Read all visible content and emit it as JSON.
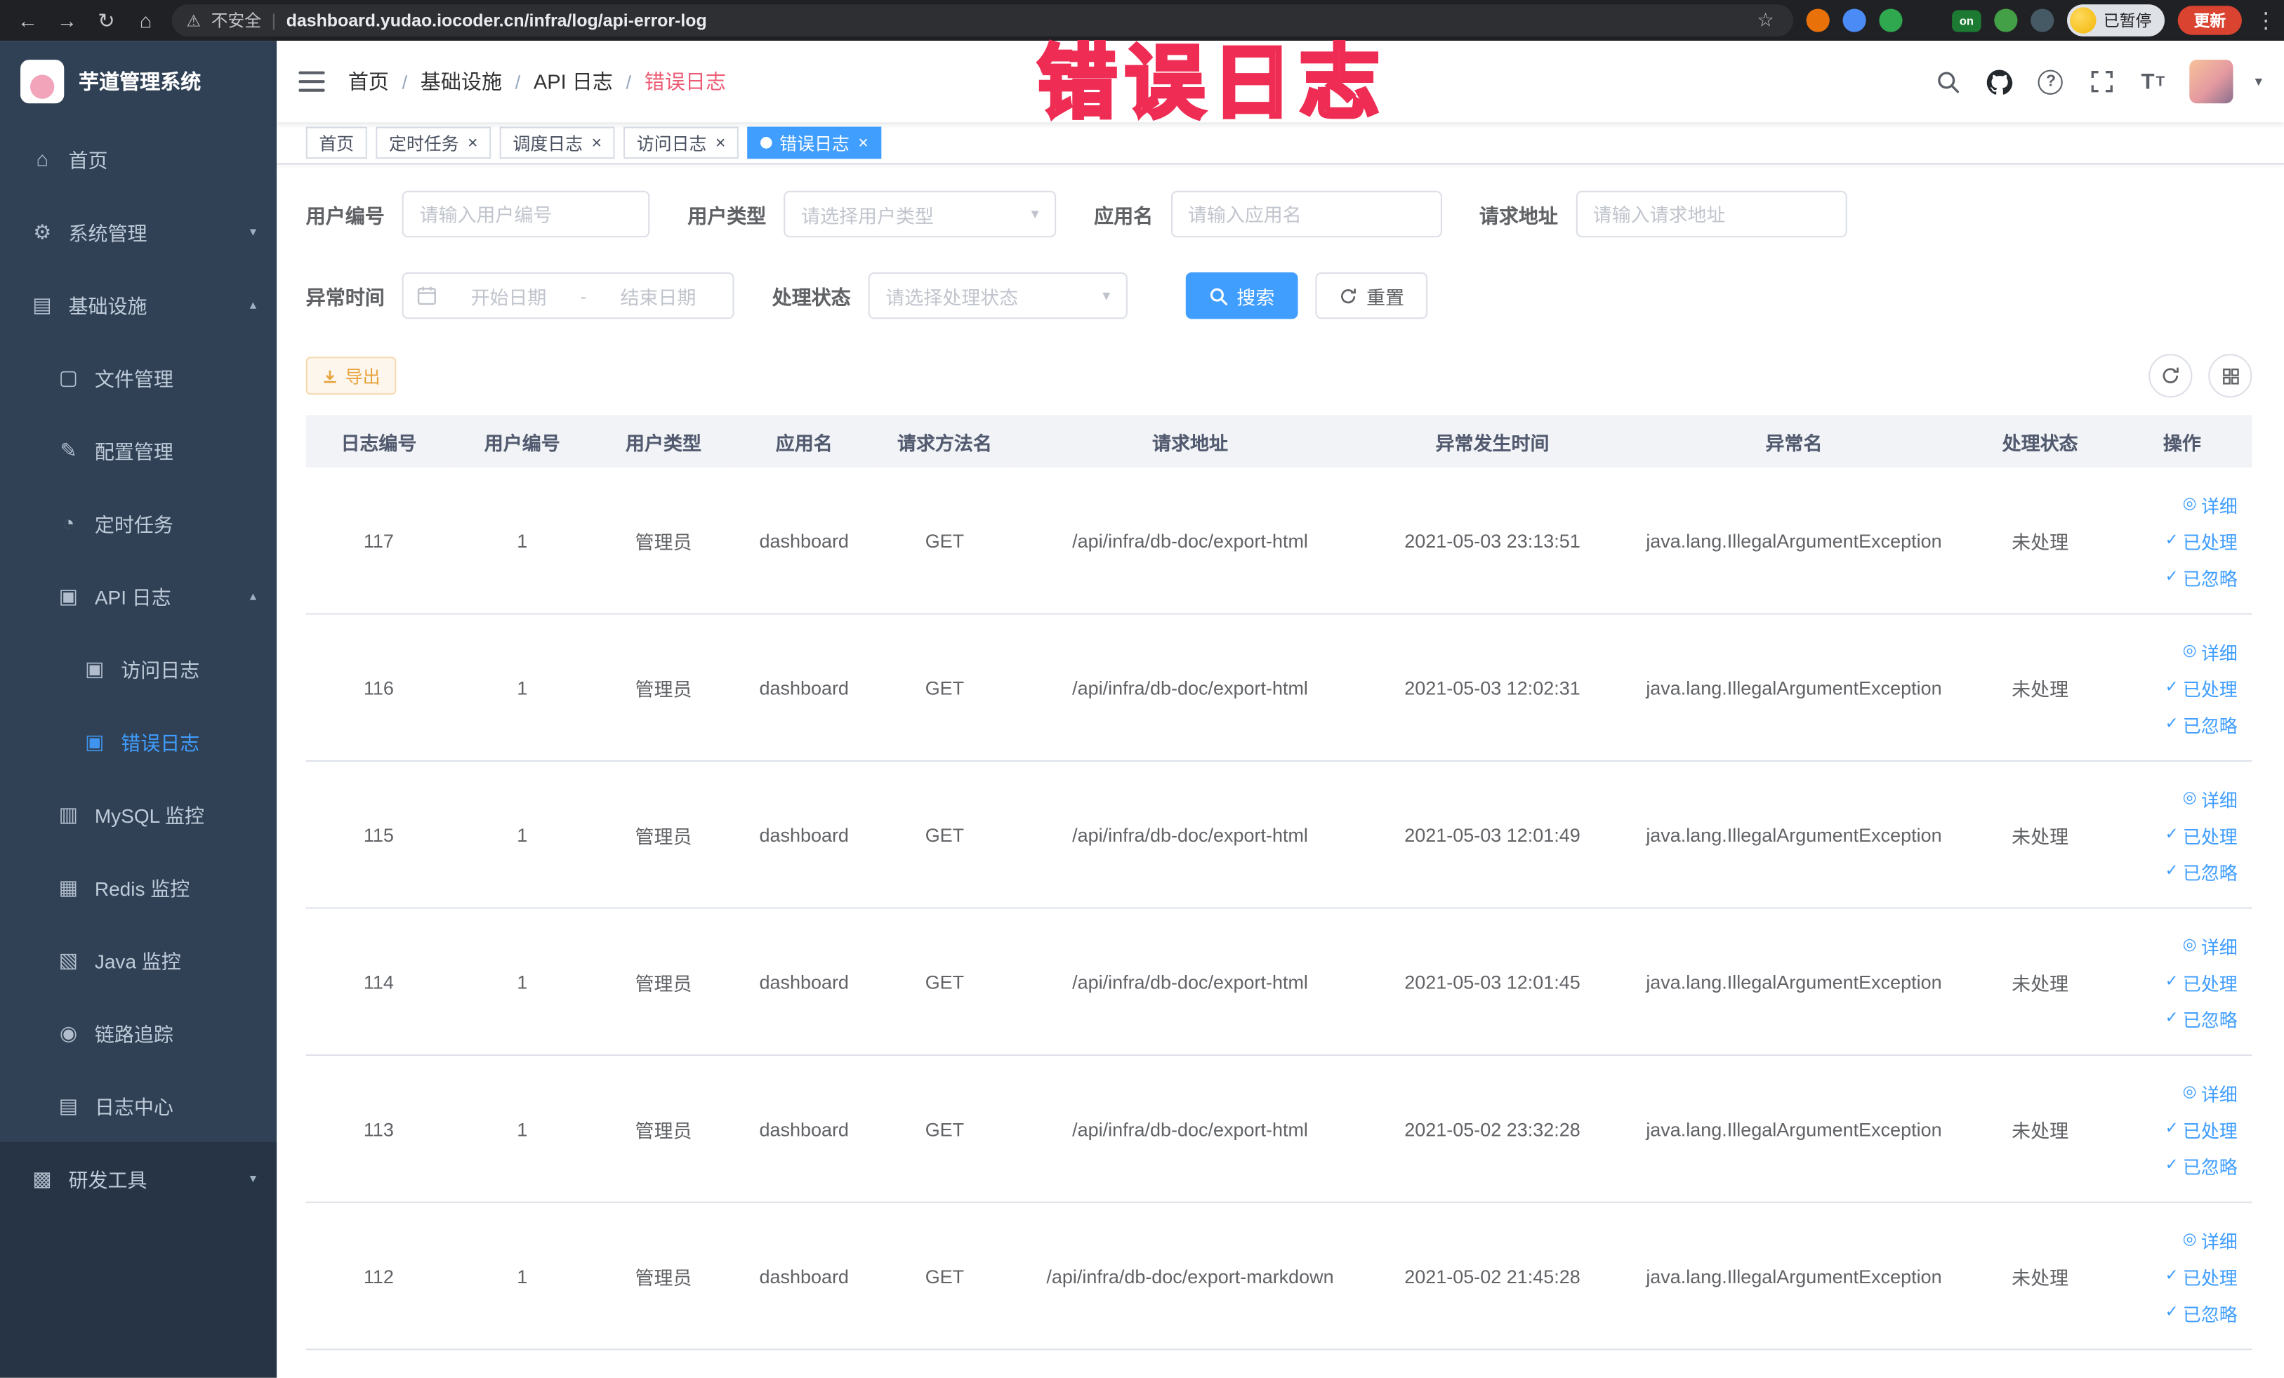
{
  "colors": {
    "primary": "#409eff",
    "sidebar_bg": "#304156",
    "annotation_red": "#ee2c54",
    "warning_orange": "#e6a23c",
    "active_tab": "#409eff"
  },
  "annotation": "错误日志",
  "browser": {
    "security_label": "不安全",
    "url": "dashboard.yudao.iocoder.cn/infra/log/api-error-log",
    "paused_badge": "已暂停",
    "update_button": "更新",
    "extensions": [
      {
        "name": "extension-icon-1",
        "color": "#e8710a",
        "shape": "circle"
      },
      {
        "name": "extension-icon-2",
        "color": "#4b8bf5",
        "shape": "circle"
      },
      {
        "name": "extension-icon-3",
        "color": "#2fa84f",
        "shape": "circle"
      },
      {
        "name": "extension-icon-4",
        "color": "#4285f4",
        "shape": "grid"
      },
      {
        "name": "extension-icon-on-badge",
        "color": "#1d7a33",
        "shape": "square",
        "label": "on"
      },
      {
        "name": "extension-icon-6",
        "color": "#43a047",
        "shape": "circle"
      },
      {
        "name": "extension-icon-7",
        "color": "#455a64",
        "shape": "circle"
      }
    ]
  },
  "sidebar": {
    "title": "芋道管理系统",
    "items": [
      {
        "key": "home",
        "label": "首页",
        "icon": "home-icon",
        "level": 0
      },
      {
        "key": "system-management",
        "label": "系统管理",
        "icon": "gear-icon",
        "level": 0,
        "expandable": true,
        "expanded": false
      },
      {
        "key": "infrastructure",
        "label": "基础设施",
        "icon": "infrastructure-icon",
        "level": 0,
        "expandable": true,
        "expanded": true
      },
      {
        "key": "file-management",
        "label": "文件管理",
        "icon": "file-icon",
        "level": 1
      },
      {
        "key": "config-management",
        "label": "配置管理",
        "icon": "config-icon",
        "level": 1
      },
      {
        "key": "scheduled-jobs",
        "label": "定时任务",
        "icon": "timer-icon",
        "level": 1
      },
      {
        "key": "api-log",
        "label": "API 日志",
        "icon": "api-log-icon",
        "level": 1,
        "expandable": true,
        "expanded": true
      },
      {
        "key": "access-log",
        "label": "访问日志",
        "icon": "access-log-icon",
        "level": 2
      },
      {
        "key": "error-log",
        "label": "错误日志",
        "icon": "error-log-icon",
        "level": 2,
        "active": true
      },
      {
        "key": "mysql-monitor",
        "label": "MySQL 监控",
        "icon": "mysql-icon",
        "level": 1
      },
      {
        "key": "redis-monitor",
        "label": "Redis 监控",
        "icon": "redis-icon",
        "level": 1
      },
      {
        "key": "java-monitor",
        "label": "Java 监控",
        "icon": "java-icon",
        "level": 1
      },
      {
        "key": "trace",
        "label": "链路追踪",
        "icon": "trace-icon",
        "level": 1
      },
      {
        "key": "log-center",
        "label": "日志中心",
        "icon": "log-center-icon",
        "level": 1
      },
      {
        "key": "dev-tools",
        "label": "研发工具",
        "icon": "devtools-icon",
        "level": 0,
        "expandable": true,
        "expanded": false,
        "section": "dark"
      }
    ]
  },
  "header": {
    "breadcrumb": [
      "首页",
      "基础设施",
      "API 日志",
      "错误日志"
    ]
  },
  "tabs": [
    {
      "key": "home",
      "label": "首页",
      "closable": false,
      "active": false
    },
    {
      "key": "scheduled-jobs",
      "label": "定时任务",
      "closable": true,
      "active": false
    },
    {
      "key": "schedule-log",
      "label": "调度日志",
      "closable": true,
      "active": false
    },
    {
      "key": "access-log",
      "label": "访问日志",
      "closable": true,
      "active": false
    },
    {
      "key": "error-log",
      "label": "错误日志",
      "closable": true,
      "active": true
    }
  ],
  "filters": {
    "user_id": {
      "label": "用户编号",
      "placeholder": "请输入用户编号"
    },
    "user_type": {
      "label": "用户类型",
      "placeholder": "请选择用户类型"
    },
    "app_name": {
      "label": "应用名",
      "placeholder": "请输入应用名"
    },
    "request_url": {
      "label": "请求地址",
      "placeholder": "请输入请求地址"
    },
    "exception_time": {
      "label": "异常时间",
      "start_placeholder": "开始日期",
      "separator": "-",
      "end_placeholder": "结束日期"
    },
    "process_status": {
      "label": "处理状态",
      "placeholder": "请选择处理状态"
    },
    "search_button": "搜索",
    "reset_button": "重置"
  },
  "toolbar": {
    "export_button": "导出"
  },
  "table": {
    "columns": [
      "日志编号",
      "用户编号",
      "用户类型",
      "应用名",
      "请求方法名",
      "请求地址",
      "异常发生时间",
      "异常名",
      "处理状态",
      "操作"
    ],
    "actions": [
      "详细",
      "已处理",
      "已忽略"
    ],
    "rows": [
      {
        "log_id": "117",
        "user_id": "1",
        "user_type": "管理员",
        "app_name": "dashboard",
        "method": "GET",
        "url": "/api/infra/db-doc/export-html",
        "time": "2021-05-03 23:13:51",
        "exception": "java.lang.IllegalArgumentException",
        "status": "未处理"
      },
      {
        "log_id": "116",
        "user_id": "1",
        "user_type": "管理员",
        "app_name": "dashboard",
        "method": "GET",
        "url": "/api/infra/db-doc/export-html",
        "time": "2021-05-03 12:02:31",
        "exception": "java.lang.IllegalArgumentException",
        "status": "未处理"
      },
      {
        "log_id": "115",
        "user_id": "1",
        "user_type": "管理员",
        "app_name": "dashboard",
        "method": "GET",
        "url": "/api/infra/db-doc/export-html",
        "time": "2021-05-03 12:01:49",
        "exception": "java.lang.IllegalArgumentException",
        "status": "未处理"
      },
      {
        "log_id": "114",
        "user_id": "1",
        "user_type": "管理员",
        "app_name": "dashboard",
        "method": "GET",
        "url": "/api/infra/db-doc/export-html",
        "time": "2021-05-03 12:01:45",
        "exception": "java.lang.IllegalArgumentException",
        "status": "未处理"
      },
      {
        "log_id": "113",
        "user_id": "1",
        "user_type": "管理员",
        "app_name": "dashboard",
        "method": "GET",
        "url": "/api/infra/db-doc/export-html",
        "time": "2021-05-02 23:32:28",
        "exception": "java.lang.IllegalArgumentException",
        "status": "未处理"
      },
      {
        "log_id": "112",
        "user_id": "1",
        "user_type": "管理员",
        "app_name": "dashboard",
        "method": "GET",
        "url": "/api/infra/db-doc/export-markdown",
        "time": "2021-05-02 21:45:28",
        "exception": "java.lang.IllegalArgumentException",
        "status": "未处理"
      }
    ]
  }
}
